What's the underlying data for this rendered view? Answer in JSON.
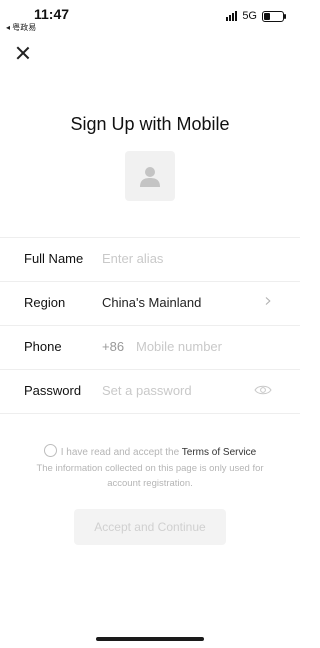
{
  "status": {
    "time": "11:47",
    "carrier": "◂ 粤政易",
    "network": "5G",
    "battery_level": 0.35
  },
  "header": {
    "close_icon": "close-icon",
    "title": "Sign Up with Mobile"
  },
  "avatar": {
    "icon": "person-icon"
  },
  "form": {
    "full_name": {
      "label": "Full Name",
      "placeholder": "Enter alias"
    },
    "region": {
      "label": "Region",
      "value": "China's Mainland",
      "icon": "chevron-right-icon"
    },
    "phone": {
      "label": "Phone",
      "code": "+86",
      "placeholder": "Mobile number"
    },
    "password": {
      "label": "Password",
      "placeholder": "Set a password",
      "icon": "eye-icon"
    }
  },
  "terms": {
    "prefix": "I have read and accept the",
    "link": "Terms of Service",
    "info": "The information collected on this page is only used for account registration."
  },
  "actions": {
    "continue_label": "Accept and Continue"
  }
}
